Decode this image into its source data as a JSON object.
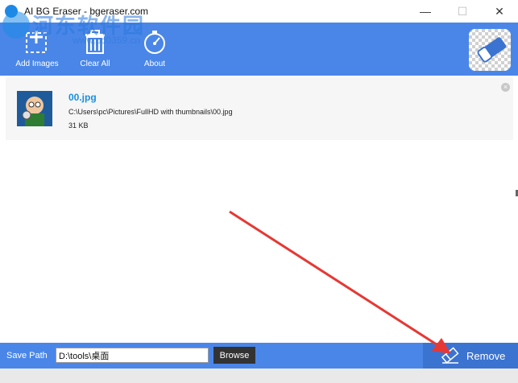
{
  "window": {
    "title": "AI BG Eraser - bgeraser.com",
    "controls": {
      "minimize": "—",
      "maximize": "☐",
      "close": "✕"
    }
  },
  "watermark": {
    "text": "河东软件园",
    "sub": "www.pc0359.cn"
  },
  "toolbar": {
    "add_images_label": "Add Images",
    "clear_all_label": "Clear All",
    "about_label": "About"
  },
  "files": [
    {
      "name": "00.jpg",
      "path": "C:\\Users\\pc\\Pictures\\FullHD with thumbnails\\00.jpg",
      "size": "31 KB"
    }
  ],
  "footer": {
    "save_path_label": "Save Path",
    "save_path_value": "D:\\tools\\桌面",
    "browse_label": "Browse",
    "remove_label": "Remove"
  },
  "colors": {
    "accent": "#4a86e8",
    "remove_button": "#3b73d1",
    "file_name": "#1a8fe0",
    "annotation_arrow": "#e53935"
  },
  "icons": {
    "add": "add-images-icon",
    "clear": "trash-icon",
    "about": "compass-icon",
    "logo": "eraser-logo-icon",
    "remove": "eraser-icon"
  }
}
